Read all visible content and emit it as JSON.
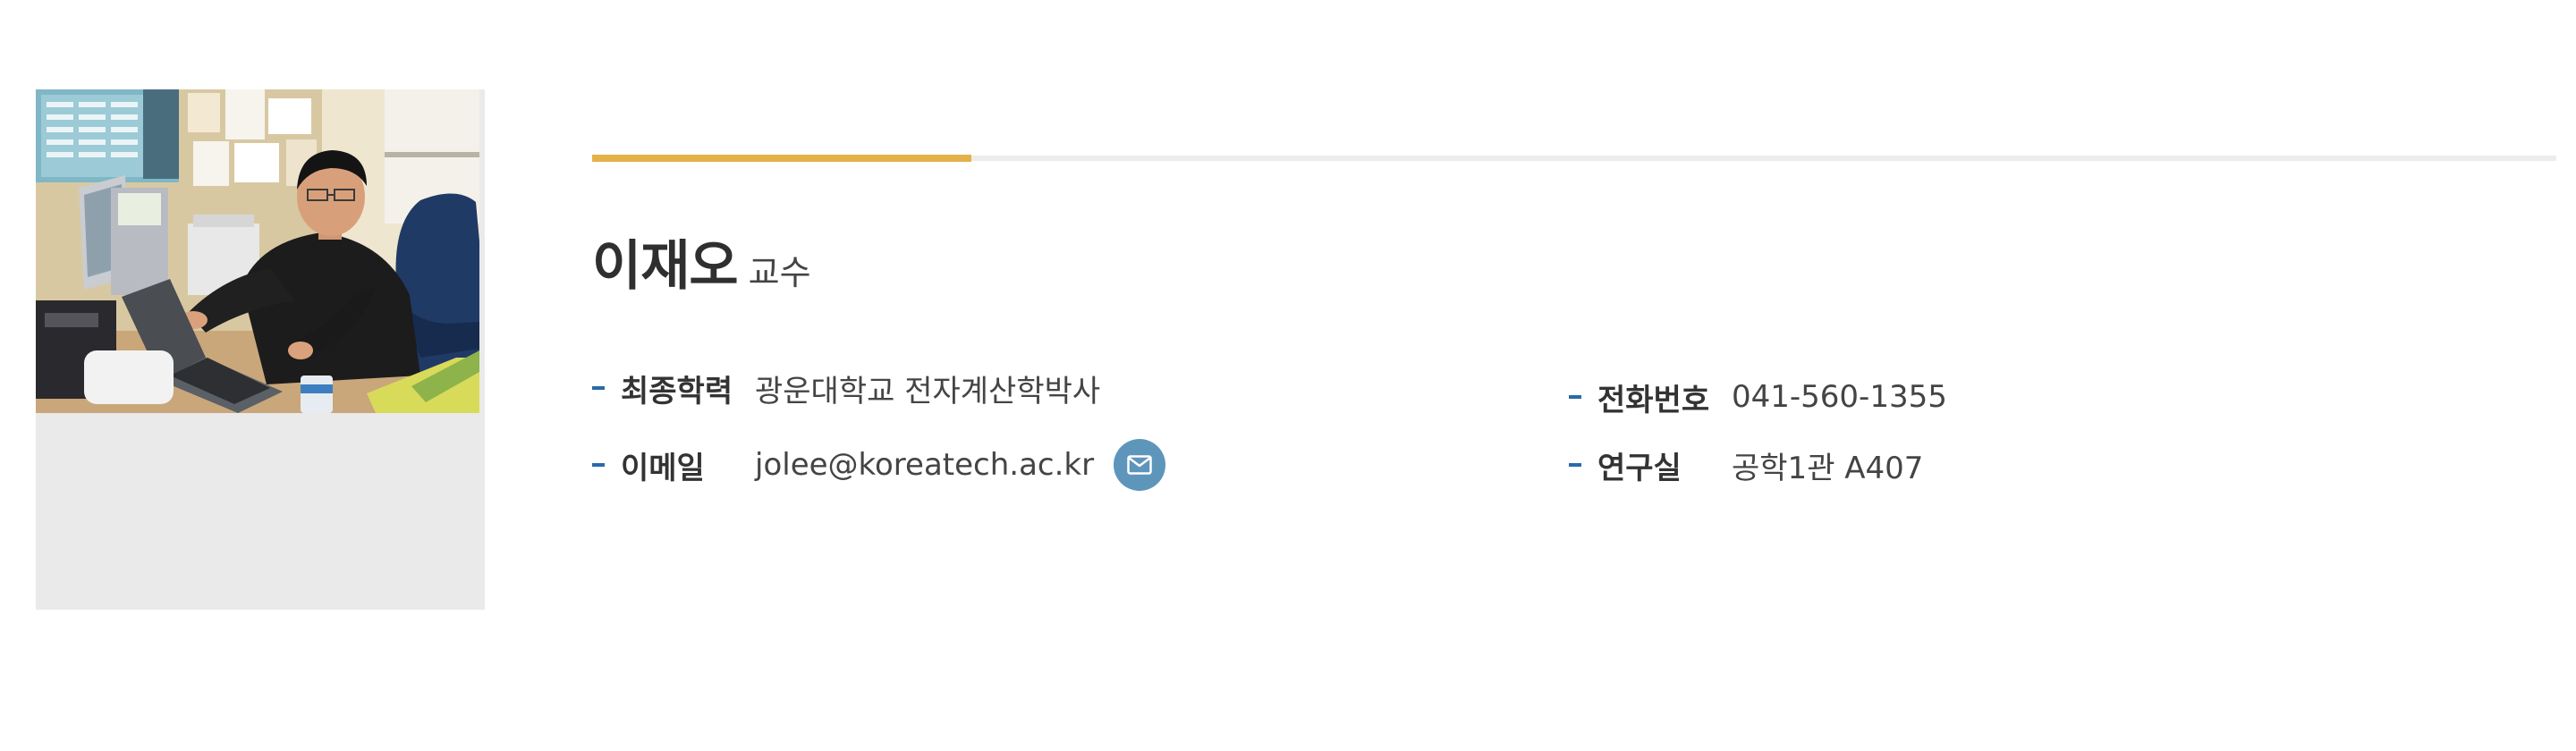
{
  "professor": {
    "name": "이재오",
    "title": "교수"
  },
  "details": {
    "education_label": "최종학력",
    "education_value": "광운대학교 전자계산학박사",
    "phone_label": "전화번호",
    "phone_value": "041-560-1355",
    "email_label": "이메일",
    "email_value": "jolee@koreatech.ac.kr",
    "office_label": "연구실",
    "office_value": "공학1관 A407"
  },
  "icons": {
    "email_button": "mail-icon",
    "list_marker": "dash-bullet"
  },
  "colors": {
    "accent_bar": "#e5b24a",
    "divider": "#ececec",
    "bullet": "#2a6aa8",
    "mail_button": "#5e95bb",
    "photo_placeholder": "#eaeaea"
  }
}
